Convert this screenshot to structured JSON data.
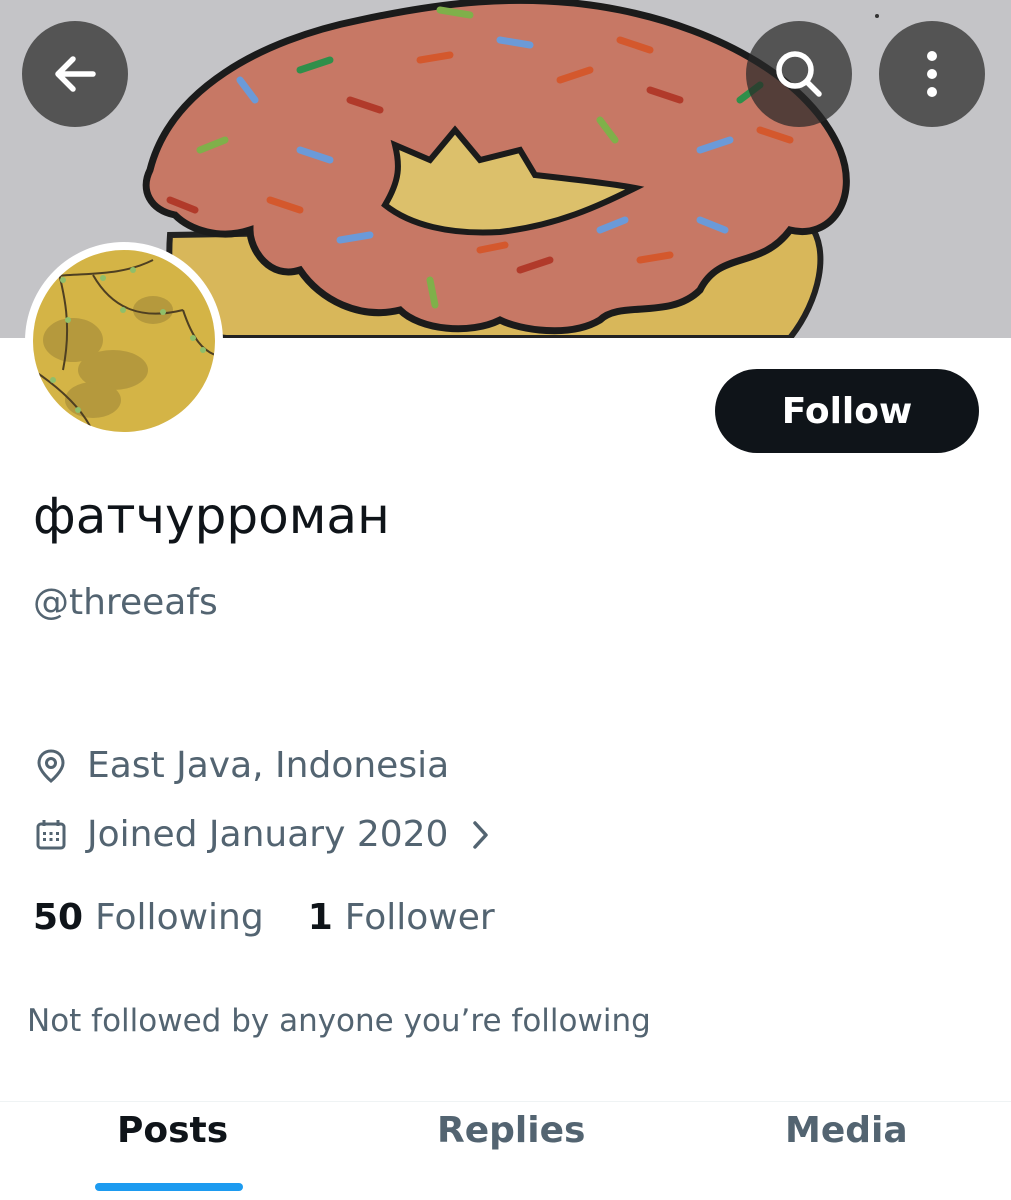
{
  "colors": {
    "text_primary": "#0f1419",
    "text_secondary": "#536471",
    "accent": "#1d9bf0",
    "follow_button_bg": "#0f1419"
  },
  "header": {
    "back_icon": "arrow-left-icon",
    "search_icon": "search-icon",
    "more_icon": "more-vertical-icon"
  },
  "banner": {
    "image": "hand-drawn donut with pink frosting and sprinkles"
  },
  "avatar": {
    "image": "yellow wall with shadows of tree branches"
  },
  "follow_button": {
    "label": "Follow"
  },
  "profile": {
    "display_name": "фатчурроман",
    "handle": "@threeafs",
    "location": "East Java, Indonesia",
    "location_icon": "location-pin-icon",
    "joined": "Joined January 2020",
    "joined_icon": "calendar-icon",
    "following_count": "50",
    "following_label": "Following",
    "followers_count": "1",
    "followers_label": "Follower",
    "not_followed_text": "Not followed by anyone you’re following"
  },
  "tabs": [
    {
      "label": "Posts",
      "active": true
    },
    {
      "label": "Replies",
      "active": false
    },
    {
      "label": "Media",
      "active": false
    }
  ]
}
